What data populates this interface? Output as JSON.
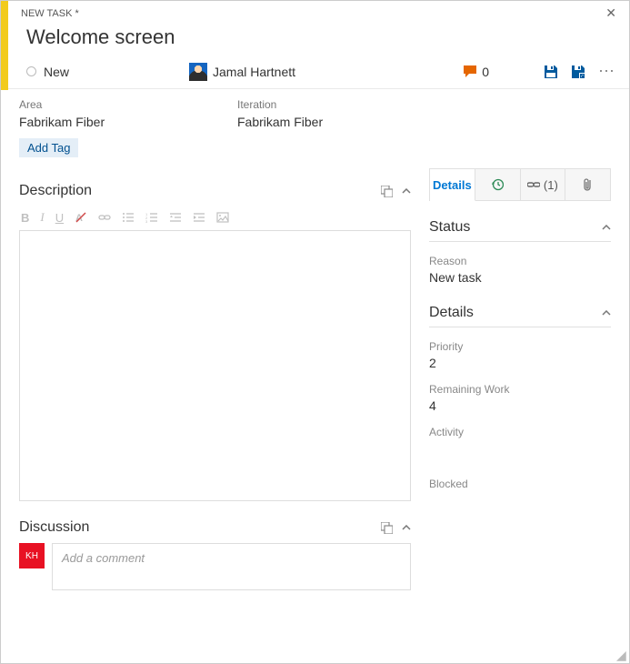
{
  "breadcrumb": "NEW TASK *",
  "title": "Welcome screen",
  "state": "New",
  "assignee": "Jamal Hartnett",
  "comment_count": "0",
  "fields": {
    "area": {
      "label": "Area",
      "value": "Fabrikam Fiber"
    },
    "iteration": {
      "label": "Iteration",
      "value": "Fabrikam Fiber"
    }
  },
  "add_tag_label": "Add Tag",
  "tabs": {
    "details": "Details",
    "links_count": "(1)"
  },
  "sections": {
    "description": "Description",
    "discussion": "Discussion",
    "status": "Status",
    "details": "Details"
  },
  "status": {
    "reason_label": "Reason",
    "reason_value": "New task"
  },
  "details": {
    "priority_label": "Priority",
    "priority_value": "2",
    "remaining_label": "Remaining Work",
    "remaining_value": "4",
    "activity_label": "Activity",
    "blocked_label": "Blocked"
  },
  "comment_placeholder": "Add a comment",
  "user_initials": "KH"
}
